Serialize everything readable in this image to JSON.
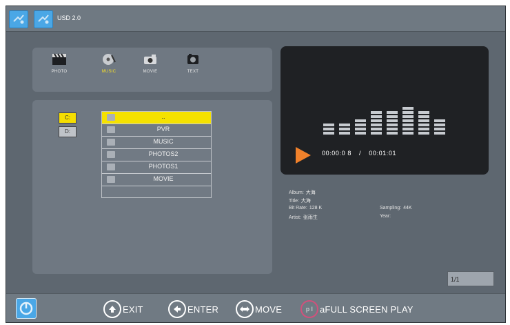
{
  "topbar": {
    "title": "USD 2.0"
  },
  "categories": [
    {
      "label": "PHOTO",
      "icon": "film-clapper-icon",
      "selected": false
    },
    {
      "label": "MUSIC",
      "icon": "music-disc-icon",
      "selected": true
    },
    {
      "label": "MOVIE",
      "icon": "camera-icon",
      "selected": false
    },
    {
      "label": "TEXT",
      "icon": "text-icon",
      "selected": false
    }
  ],
  "drives": [
    "C:",
    "D:"
  ],
  "files": [
    "..",
    "PVR",
    "MUSIC",
    "PHOTOS2",
    "PHOTOS1",
    "MOVIE"
  ],
  "player": {
    "elapsed": "00:00:0  8",
    "separator": "/",
    "total": "00:01:01",
    "equalizer_levels": [
      3,
      3,
      4,
      6,
      6,
      7,
      6,
      4,
      2,
      4
    ]
  },
  "meta": {
    "album_label": "Album:",
    "album_value": "大海",
    "title_label": "Title:",
    "title_value": "大海",
    "bitrate_label": "Bit Rate:",
    "bitrate_value": "128 K",
    "artist_label": "Artist:",
    "artist_value": "张雨生",
    "sampling_label": "Sampling:",
    "sampling_value": "44K",
    "year_label": "Year:",
    "year_value": ""
  },
  "pagination": "1/1",
  "hints": {
    "exit": "EXIT",
    "enter": "ENTER",
    "move": "MOVE",
    "play_symbol": "p I",
    "fullscreen": "aFULL SCREEN PLAY"
  },
  "colors": {
    "selected": "#f5e200",
    "play": "#f0812b",
    "brand": "#4aa7e6"
  }
}
